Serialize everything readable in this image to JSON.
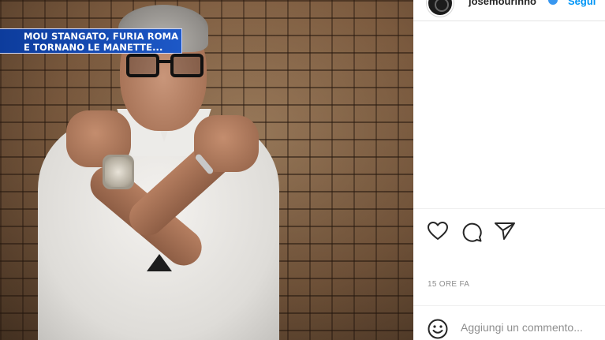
{
  "news_banner": {
    "line1": "MOU STANGATO, FURIA ROMA",
    "line2": "E TORNANO LE MANETTE..."
  },
  "post": {
    "username": "josemourinho",
    "follow_label": "Segui",
    "time_label": "15 ORE FA",
    "comment_placeholder": "Aggiungi un commento..."
  },
  "icons": {
    "like": "heart-icon",
    "comment": "comment-icon",
    "share": "share-icon",
    "emoji": "emoji-icon",
    "verified": "verified-badge-icon"
  },
  "colors": {
    "banner_blue": "#1d58c7",
    "link_blue": "#0095f6",
    "muted_gray": "#8e8e8e"
  }
}
